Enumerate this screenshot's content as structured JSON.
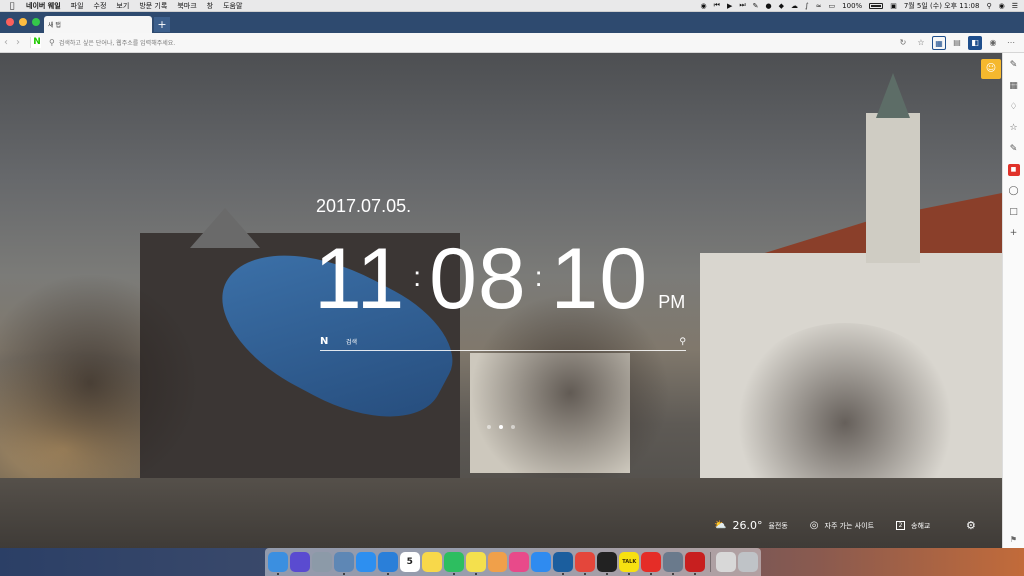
{
  "menubar": {
    "app_name": "네이버 웨일",
    "menus": [
      "파일",
      "수정",
      "보기",
      "방문 기록",
      "북마크",
      "창",
      "도움말"
    ],
    "battery": "100%",
    "datetime": "7월 5일 (수) 오후 11:08"
  },
  "tabs": [
    {
      "label": "새 탭"
    }
  ],
  "newtab_label": "+",
  "address": {
    "placeholder": "검색하고 싶은 단어나, 웹주소를 입력해주세요."
  },
  "newtab_page": {
    "date": "2017.07.05.",
    "hour": "11",
    "minute": "08",
    "second": "10",
    "separator": ":",
    "ampm": "PM",
    "search_logo": "N",
    "search_label": "검색",
    "pager": {
      "count": 3,
      "active_index": 1
    },
    "weather": {
      "temp": "26.0°",
      "location": "율전동"
    },
    "frequent_sites_label": "자주 가는 사이트",
    "memo": {
      "count": "2",
      "label": "송해교"
    }
  },
  "colors": {
    "tab_bar": "#2e4a6f",
    "accent_blue": "#1f4f8d",
    "feedback_yellow": "#f5b82e",
    "naver_green": "#1ec800"
  },
  "dock": {
    "apps": [
      {
        "icon": "finder-icon",
        "color": "#3b8fe0",
        "running": true
      },
      {
        "icon": "siri-icon",
        "color": "#5a4bd0",
        "running": false
      },
      {
        "icon": "launchpad-icon",
        "color": "#8c9aa8",
        "running": false
      },
      {
        "icon": "preview-icon",
        "color": "#5e87b5",
        "running": true
      },
      {
        "icon": "safari-icon",
        "color": "#2d8ff0",
        "running": false
      },
      {
        "icon": "xcode-icon",
        "color": "#2a7fd9",
        "running": true
      },
      {
        "icon": "calendar-icon",
        "color": "#ffffff",
        "running": false,
        "text": "5"
      },
      {
        "icon": "notes-icon",
        "color": "#f8d84a",
        "running": false
      },
      {
        "icon": "evernote-icon",
        "color": "#2dbe60",
        "running": true
      },
      {
        "icon": "stickies-icon",
        "color": "#f4e04d",
        "running": true
      },
      {
        "icon": "photos-icon",
        "color": "#f0a04a",
        "running": false
      },
      {
        "icon": "itunes-icon",
        "color": "#e84a8a",
        "running": false
      },
      {
        "icon": "appstore-icon",
        "color": "#2f8bf0",
        "running": false
      },
      {
        "icon": "whale-icon",
        "color": "#1b5e9e",
        "running": true
      },
      {
        "icon": "chrome-icon",
        "color": "#e4463b",
        "running": true
      },
      {
        "icon": "terminal-icon",
        "color": "#222222",
        "running": true
      },
      {
        "icon": "kakaotalk-icon",
        "color": "#f7e111",
        "running": true,
        "text": "TALK"
      },
      {
        "icon": "youtube-icon",
        "color": "#e52d27",
        "running": true
      },
      {
        "icon": "remote-icon",
        "color": "#6a7a8c",
        "running": true
      },
      {
        "icon": "acrobat-icon",
        "color": "#c81f1f",
        "running": true
      }
    ],
    "trailing": [
      {
        "icon": "documents-icon",
        "color": "#d8d8d8"
      },
      {
        "icon": "trash-icon",
        "color": "#bfc3c7"
      }
    ]
  }
}
